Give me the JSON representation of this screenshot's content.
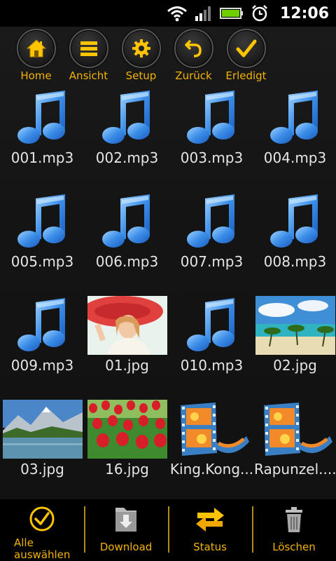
{
  "status_bar": {
    "time": "12:06",
    "icons": [
      "wifi-icon",
      "signal-icon",
      "battery-icon",
      "alarm-icon"
    ]
  },
  "toolbar": {
    "items": [
      {
        "label": "Home",
        "icon": "home-icon"
      },
      {
        "label": "Ansicht",
        "icon": "list-icon"
      },
      {
        "label": "Setup",
        "icon": "gear-icon"
      },
      {
        "label": "Zurück",
        "icon": "undo-icon"
      },
      {
        "label": "Erledigt",
        "icon": "check-icon"
      }
    ]
  },
  "files": [
    {
      "name": "001.mp3",
      "type": "audio"
    },
    {
      "name": "002.mp3",
      "type": "audio"
    },
    {
      "name": "003.mp3",
      "type": "audio"
    },
    {
      "name": "004.mp3",
      "type": "audio"
    },
    {
      "name": "005.mp3",
      "type": "audio"
    },
    {
      "name": "006.mp3",
      "type": "audio"
    },
    {
      "name": "007.mp3",
      "type": "audio"
    },
    {
      "name": "008.mp3",
      "type": "audio"
    },
    {
      "name": "009.mp3",
      "type": "audio"
    },
    {
      "name": "01.jpg",
      "type": "image",
      "subject": "woman in red hat"
    },
    {
      "name": "010.mp3",
      "type": "audio"
    },
    {
      "name": "02.jpg",
      "type": "image",
      "subject": "tropical beach"
    },
    {
      "name": "03.jpg",
      "type": "image",
      "subject": "mountain lake"
    },
    {
      "name": "16.jpg",
      "type": "image",
      "subject": "red tulips"
    },
    {
      "name": "King.Kong...",
      "type": "video"
    },
    {
      "name": "Rapunzel....",
      "type": "video"
    }
  ],
  "bottom_bar": {
    "items": [
      {
        "label": "Alle\nauswählen",
        "icon": "check-circle-icon"
      },
      {
        "label": "Download",
        "icon": "download-icon"
      },
      {
        "label": "Status",
        "icon": "swap-arrows-icon"
      },
      {
        "label": "Löschen",
        "icon": "trash-icon"
      }
    ]
  },
  "colors": {
    "accent": "#f2b300",
    "background": "#141414",
    "bar": "#000000"
  }
}
